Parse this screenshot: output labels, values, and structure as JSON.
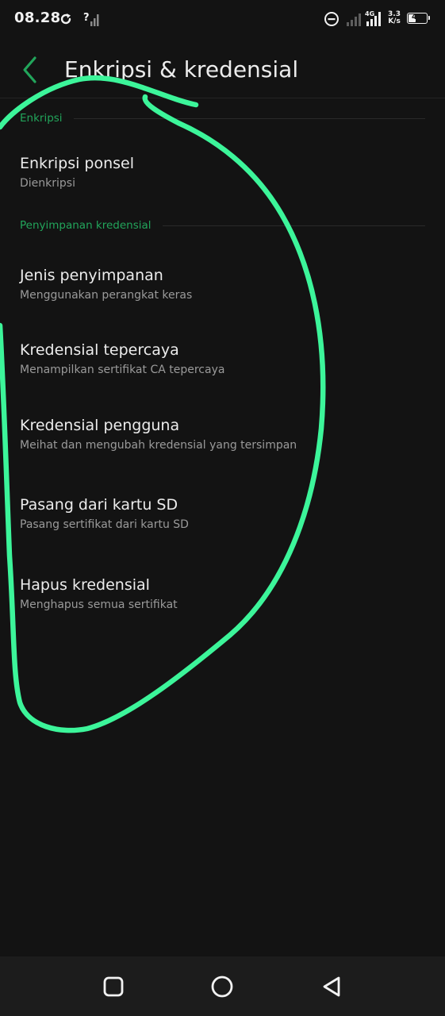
{
  "status_bar": {
    "time": "08.28",
    "network_speed_value": "3.3",
    "network_speed_unit": "K/s",
    "battery_level": "47",
    "icons": [
      "sync-icon",
      "no-signal-icon",
      "do-not-disturb-icon",
      "signal-bars-icon",
      "4g-signal-icon"
    ]
  },
  "app_bar": {
    "title": "Enkripsi & kredensial",
    "back_icon": "chevron-left-icon"
  },
  "sections": [
    {
      "label": "Enkripsi",
      "items": [
        {
          "title": "Enkripsi ponsel",
          "subtitle": "Dienkripsi"
        }
      ]
    },
    {
      "label": "Penyimpanan kredensial",
      "items": [
        {
          "title": "Jenis penyimpanan",
          "subtitle": "Menggunakan perangkat keras"
        },
        {
          "title": "Kredensial tepercaya",
          "subtitle": "Menampilkan sertifikat CA tepercaya"
        },
        {
          "title": "Kredensial pengguna",
          "subtitle": "Meihat dan mengubah kredensial yang tersimpan"
        },
        {
          "title": "Pasang dari kartu SD",
          "subtitle": "Pasang sertifikat dari kartu SD"
        },
        {
          "title": "Hapus kredensial",
          "subtitle": "Menghapus semua sertifikat"
        }
      ]
    }
  ],
  "nav_bar": {
    "icons": [
      "recents-square-icon",
      "home-circle-icon",
      "back-triangle-icon"
    ]
  },
  "colors": {
    "background": "#131313",
    "accent": "#22a55b",
    "annotation": "#3cf59a",
    "nav_background": "#1c1c1c"
  }
}
